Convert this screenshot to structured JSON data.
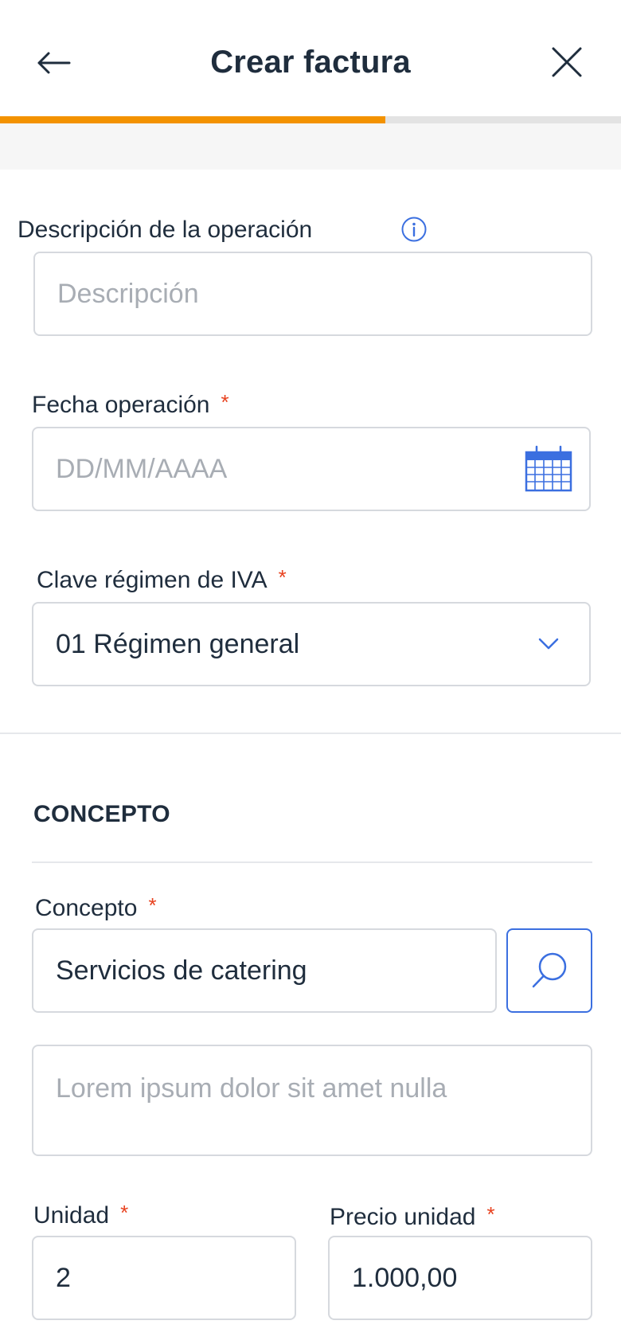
{
  "header": {
    "title": "Crear factura",
    "back_icon": "arrow-left-icon",
    "close_icon": "close-icon"
  },
  "progress": {
    "fraction": 0.62,
    "fill_color": "#f39200",
    "track_color": "#e3e3e3"
  },
  "operation": {
    "description_label": "Descripción de la operación",
    "info_icon": "info-icon",
    "description_placeholder": "Descripción",
    "date_label": "Fecha operación",
    "date_placeholder": "DD/MM/AAAA",
    "calendar_icon": "calendar-icon",
    "regime_label": "Clave régimen de IVA",
    "regime_value": "01 Régimen general",
    "chevron_icon": "chevron-down-icon"
  },
  "concept": {
    "section_title": "CONCEPTO",
    "concept_label": "Concepto",
    "concept_value": "Servicios de catering",
    "search_icon": "search-icon",
    "detail_placeholder": "Lorem ipsum dolor sit amet nulla",
    "unit_label": "Unidad",
    "unit_value": "2",
    "price_label": "Precio unidad",
    "price_value": "1.000,00"
  },
  "required_mark": "*",
  "colors": {
    "accent": "#3b6fe0",
    "required": "#e8421f",
    "text": "#1f2d3d"
  }
}
